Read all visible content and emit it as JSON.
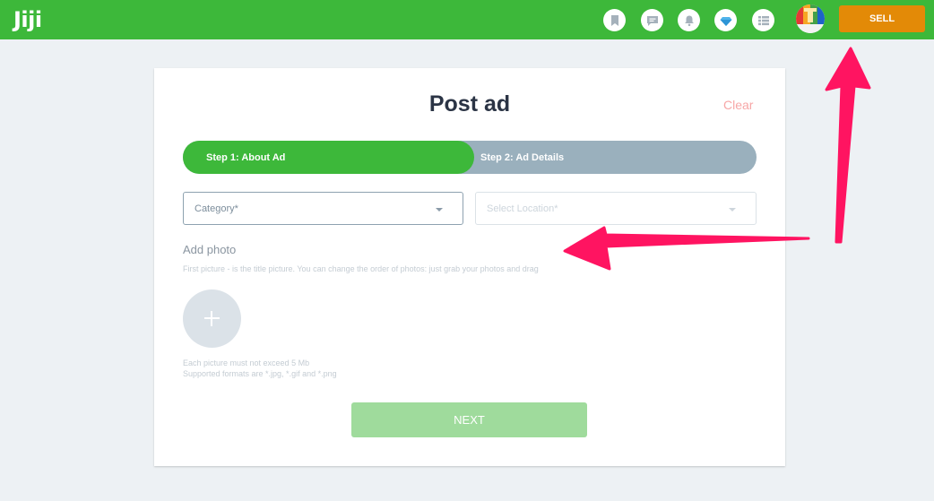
{
  "header": {
    "logo": "Jiji",
    "icons": [
      {
        "name": "bookmark-icon",
        "label": "Saved"
      },
      {
        "name": "messages-icon",
        "label": "Messages"
      },
      {
        "name": "notifications-icon",
        "label": "Notifications"
      },
      {
        "name": "premium-diamond-icon",
        "label": "Premium"
      },
      {
        "name": "my-adverts-icon",
        "label": "My adverts"
      }
    ],
    "sell_label": "SELL",
    "colors": {
      "brand": "#3db83a",
      "sell": "#e38a07"
    }
  },
  "form": {
    "title": "Post ad",
    "clear_label": "Clear",
    "steps": [
      {
        "label": "Step 1: About Ad",
        "active": true
      },
      {
        "label": "Step 2: Ad Details",
        "active": false
      }
    ],
    "category_placeholder": "Category*",
    "location_placeholder": "Select Location*",
    "add_photo_label": "Add photo",
    "photo_hint": "First picture - is the title picture. You can change the order of photos: just grab your photos and drag",
    "photo_limit_size": "Each picture must not exceed 5 Mb",
    "photo_limit_formats": "Supported formats are *.jpg, *.gif and *.png",
    "next_label": "NEXT"
  },
  "annotations": {
    "arrow_color": "#ff1461",
    "arrows": [
      "pointing-to-sell-button",
      "pointing-to-add-photo-area"
    ]
  }
}
